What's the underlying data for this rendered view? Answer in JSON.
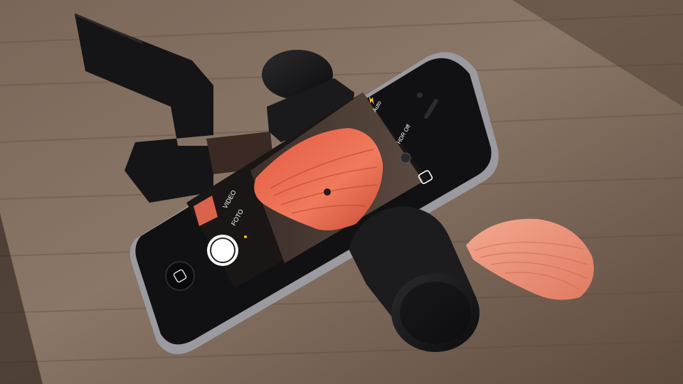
{
  "scene": {
    "description_free": true
  },
  "camera_ui": {
    "flash_label": "Auto",
    "hdr_label": "HDR Off",
    "mode_video": "VIDEO",
    "mode_photo": "FOTO",
    "shutter_icon": "shutter-button",
    "switch_camera_icon": "switch-camera-icon",
    "flash_icon": "flash-icon"
  },
  "colors": {
    "wood_dark": "#4a3a30",
    "wood_light": "#8a7363",
    "strap": "#151517",
    "phone_body": "#111113",
    "phone_frame": "#9a9aa0",
    "shell": "#e8674e",
    "shell_small": "#f0a184",
    "mode_accent": "#f2c200"
  }
}
